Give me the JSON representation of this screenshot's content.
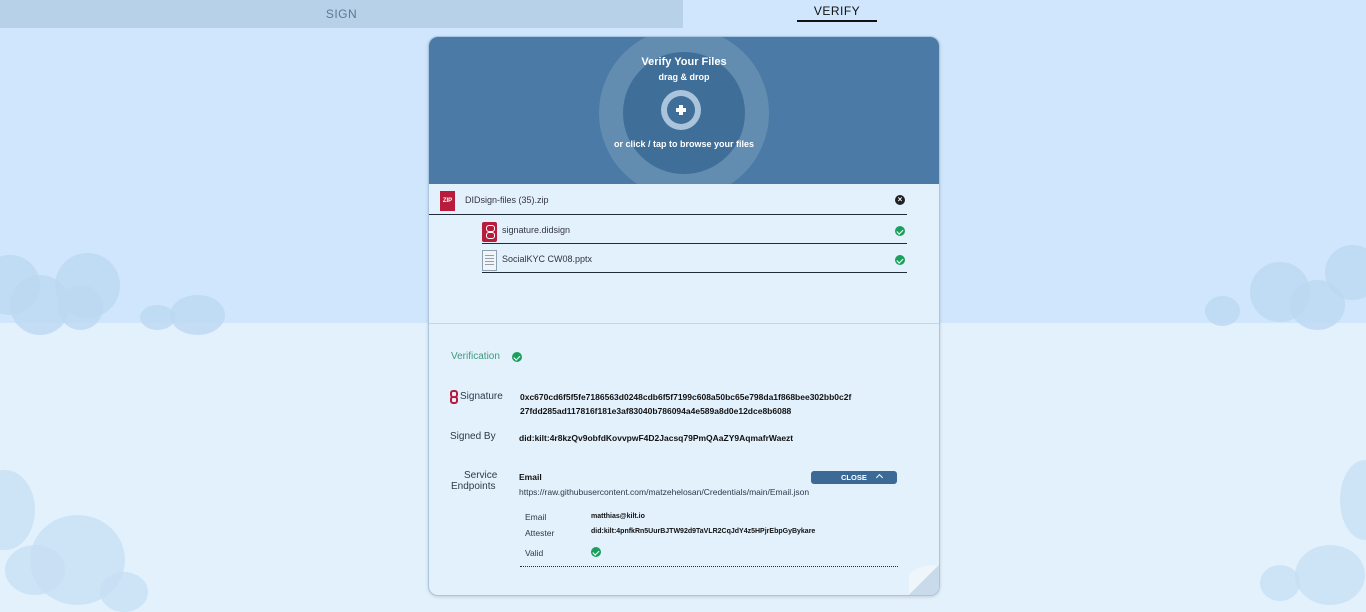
{
  "tabs": {
    "sign": "SIGN",
    "verify": "VERIFY"
  },
  "dropzone": {
    "title": "Verify Your Files",
    "subtitle": "drag & drop",
    "browse": "or click / tap to browse your files"
  },
  "files": {
    "zip": {
      "icon_text": "ZIP",
      "name": "DIDsign-files (35).zip"
    },
    "signature": {
      "name": "signature.didsign"
    },
    "document": {
      "name": "SocialKYC CW08.pptx"
    }
  },
  "verification": {
    "label": "Verification",
    "signature_label": "Signature",
    "signature_line1": "0xc670cd6f5f5fe7186563d0248cdb6f5f7199c608a50bc65e798da1f868bee302bb0c2f",
    "signature_line2": "27fdd285ad117816f181e3af83040b786094a4e589a8d0e12dce8b6088",
    "signed_by_label": "Signed By",
    "signed_by": "did:kilt:4r8kzQv9obfdKovvpwF4D2Jacsq79PmQAaZY9AqmafrWaezt",
    "endpoints_label_1": "Service",
    "endpoints_label_2": "Endpoints",
    "endpoint": {
      "type": "Email",
      "url": "https://raw.githubusercontent.com/matzehelosan/Credentials/main/Email.json",
      "close_label": "CLOSE",
      "email_label": "Email",
      "email_value": "matthias@kilt.io",
      "attester_label": "Attester",
      "attester_value": "did:kilt:4pnfkRn5UurBJTW92d9TaVLR2CqJdY4z5HPjrEbpGyBykare",
      "valid_label": "Valid"
    }
  },
  "colors": {
    "accent": "#4a7aa5",
    "success": "#1aa05c",
    "brand_red": "#b71c3c"
  }
}
